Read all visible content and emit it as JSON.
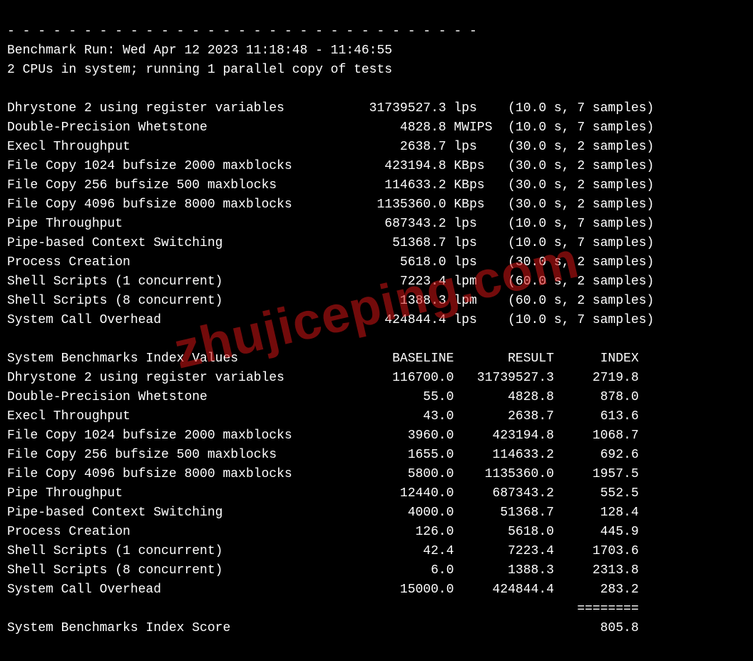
{
  "separator": "- - - - - - - - - - - - - - - - - - - - - - - - - - - - - - -",
  "run_header": "Benchmark Run: Wed Apr 12 2023 11:18:48 - 11:46:55",
  "cpu_header": "2 CPUs in system; running 1 parallel copy of tests",
  "watermark": "zhujiceping.com",
  "tests": [
    {
      "name": "Dhrystone 2 using register variables",
      "value": "31739527.3",
      "unit": "lps",
      "timing": "(10.0 s, 7 samples)"
    },
    {
      "name": "Double-Precision Whetstone",
      "value": "4828.8",
      "unit": "MWIPS",
      "timing": "(10.0 s, 7 samples)"
    },
    {
      "name": "Execl Throughput",
      "value": "2638.7",
      "unit": "lps",
      "timing": "(30.0 s, 2 samples)"
    },
    {
      "name": "File Copy 1024 bufsize 2000 maxblocks",
      "value": "423194.8",
      "unit": "KBps",
      "timing": "(30.0 s, 2 samples)"
    },
    {
      "name": "File Copy 256 bufsize 500 maxblocks",
      "value": "114633.2",
      "unit": "KBps",
      "timing": "(30.0 s, 2 samples)"
    },
    {
      "name": "File Copy 4096 bufsize 8000 maxblocks",
      "value": "1135360.0",
      "unit": "KBps",
      "timing": "(30.0 s, 2 samples)"
    },
    {
      "name": "Pipe Throughput",
      "value": "687343.2",
      "unit": "lps",
      "timing": "(10.0 s, 7 samples)"
    },
    {
      "name": "Pipe-based Context Switching",
      "value": "51368.7",
      "unit": "lps",
      "timing": "(10.0 s, 7 samples)"
    },
    {
      "name": "Process Creation",
      "value": "5618.0",
      "unit": "lps",
      "timing": "(30.0 s, 2 samples)"
    },
    {
      "name": "Shell Scripts (1 concurrent)",
      "value": "7223.4",
      "unit": "lpm",
      "timing": "(60.0 s, 2 samples)"
    },
    {
      "name": "Shell Scripts (8 concurrent)",
      "value": "1388.3",
      "unit": "lpm",
      "timing": "(60.0 s, 2 samples)"
    },
    {
      "name": "System Call Overhead",
      "value": "424844.4",
      "unit": "lps",
      "timing": "(10.0 s, 7 samples)"
    }
  ],
  "index_header": {
    "title": "System Benchmarks Index Values",
    "col_baseline": "BASELINE",
    "col_result": "RESULT",
    "col_index": "INDEX"
  },
  "index_rows": [
    {
      "name": "Dhrystone 2 using register variables",
      "baseline": "116700.0",
      "result": "31739527.3",
      "index": "2719.8"
    },
    {
      "name": "Double-Precision Whetstone",
      "baseline": "55.0",
      "result": "4828.8",
      "index": "878.0"
    },
    {
      "name": "Execl Throughput",
      "baseline": "43.0",
      "result": "2638.7",
      "index": "613.6"
    },
    {
      "name": "File Copy 1024 bufsize 2000 maxblocks",
      "baseline": "3960.0",
      "result": "423194.8",
      "index": "1068.7"
    },
    {
      "name": "File Copy 256 bufsize 500 maxblocks",
      "baseline": "1655.0",
      "result": "114633.2",
      "index": "692.6"
    },
    {
      "name": "File Copy 4096 bufsize 8000 maxblocks",
      "baseline": "5800.0",
      "result": "1135360.0",
      "index": "1957.5"
    },
    {
      "name": "Pipe Throughput",
      "baseline": "12440.0",
      "result": "687343.2",
      "index": "552.5"
    },
    {
      "name": "Pipe-based Context Switching",
      "baseline": "4000.0",
      "result": "51368.7",
      "index": "128.4"
    },
    {
      "name": "Process Creation",
      "baseline": "126.0",
      "result": "5618.0",
      "index": "445.9"
    },
    {
      "name": "Shell Scripts (1 concurrent)",
      "baseline": "42.4",
      "result": "7223.4",
      "index": "1703.6"
    },
    {
      "name": "Shell Scripts (8 concurrent)",
      "baseline": "6.0",
      "result": "1388.3",
      "index": "2313.8"
    },
    {
      "name": "System Call Overhead",
      "baseline": "15000.0",
      "result": "424844.4",
      "index": "283.2"
    }
  ],
  "index_divider": "========",
  "score_label": "System Benchmarks Index Score",
  "score_value": "805.8"
}
